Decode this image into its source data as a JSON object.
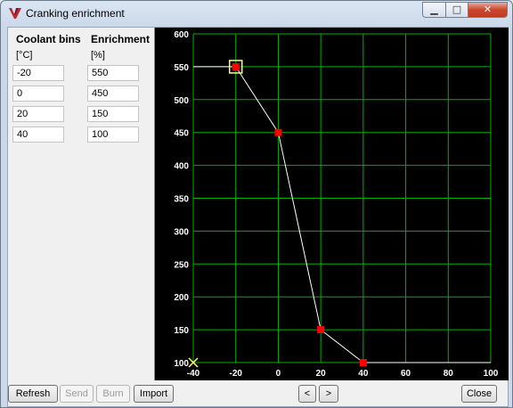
{
  "window": {
    "title": "Cranking enrichment"
  },
  "table": {
    "col1_header": "Coolant bins",
    "col1_unit": "[°C]",
    "col2_header": "Enrichment",
    "col2_unit": "[%]",
    "rows": [
      {
        "bin": "-20",
        "value": "550"
      },
      {
        "bin": "0",
        "value": "450"
      },
      {
        "bin": "20",
        "value": "150"
      },
      {
        "bin": "40",
        "value": "100"
      }
    ]
  },
  "buttons": {
    "refresh": "Refresh",
    "send": "Send",
    "burn": "Burn",
    "import": "Import",
    "prev": "<",
    "next": ">",
    "close": "Close"
  },
  "colors": {
    "grid": "#00b000",
    "line": "#ffffff",
    "point": "#ff0000",
    "selected": "#ffff66"
  },
  "chart_data": {
    "type": "line",
    "xlim": [
      -40,
      100
    ],
    "ylim": [
      100,
      600
    ],
    "xticks": [
      -40,
      -20,
      0,
      20,
      40,
      60,
      80,
      100
    ],
    "yticks": [
      100,
      150,
      200,
      250,
      300,
      350,
      400,
      450,
      500,
      550,
      600
    ],
    "grid": true,
    "series": [
      {
        "x": [
          -20,
          0,
          20,
          40
        ],
        "y": [
          550,
          450,
          150,
          100
        ]
      }
    ],
    "selected_point": {
      "x": -20,
      "y": 550
    },
    "cursor_marker": {
      "x": -40,
      "y": 100
    }
  }
}
